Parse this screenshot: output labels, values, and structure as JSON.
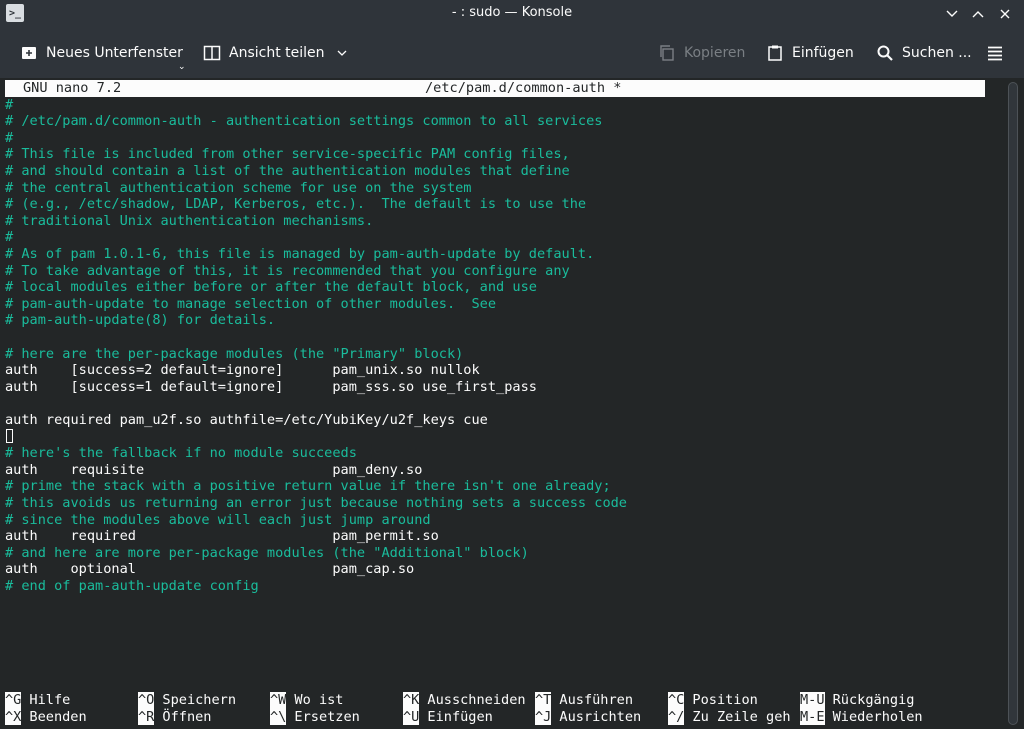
{
  "window": {
    "title": "- : sudo — Konsole",
    "app_icon_glyph": ">_"
  },
  "toolbar": {
    "new_tab": "Neues Unterfenster",
    "split_view": "Ansicht teilen",
    "copy": "Kopieren",
    "paste": "Einfügen",
    "search": "Suchen ..."
  },
  "nano": {
    "version": "GNU nano 7.2",
    "filename": "/etc/pam.d/common-auth *",
    "lines": [
      {
        "text": "#",
        "comment": true
      },
      {
        "text": "# /etc/pam.d/common-auth - authentication settings common to all services",
        "comment": true
      },
      {
        "text": "#",
        "comment": true
      },
      {
        "text": "# This file is included from other service-specific PAM config files,",
        "comment": true
      },
      {
        "text": "# and should contain a list of the authentication modules that define",
        "comment": true
      },
      {
        "text": "# the central authentication scheme for use on the system",
        "comment": true
      },
      {
        "text": "# (e.g., /etc/shadow, LDAP, Kerberos, etc.).  The default is to use the",
        "comment": true
      },
      {
        "text": "# traditional Unix authentication mechanisms.",
        "comment": true
      },
      {
        "text": "#",
        "comment": true
      },
      {
        "text": "# As of pam 1.0.1-6, this file is managed by pam-auth-update by default.",
        "comment": true
      },
      {
        "text": "# To take advantage of this, it is recommended that you configure any",
        "comment": true
      },
      {
        "text": "# local modules either before or after the default block, and use",
        "comment": true
      },
      {
        "text": "# pam-auth-update to manage selection of other modules.  See",
        "comment": true
      },
      {
        "text": "# pam-auth-update(8) for details.",
        "comment": true
      },
      {
        "text": "",
        "comment": false
      },
      {
        "text": "# here are the per-package modules (the \"Primary\" block)",
        "comment": true
      },
      {
        "text": "auth    [success=2 default=ignore]      pam_unix.so nullok",
        "comment": false
      },
      {
        "text": "auth    [success=1 default=ignore]      pam_sss.so use_first_pass",
        "comment": false
      },
      {
        "text": "",
        "comment": false
      },
      {
        "text": "auth required pam_u2f.so authfile=/etc/YubiKey/u2f_keys cue",
        "comment": false
      },
      {
        "text": "",
        "comment": false
      },
      {
        "text": "# here's the fallback if no module succeeds",
        "comment": true
      },
      {
        "text": "auth    requisite                       pam_deny.so",
        "comment": false
      },
      {
        "text": "# prime the stack with a positive return value if there isn't one already;",
        "comment": true
      },
      {
        "text": "# this avoids us returning an error just because nothing sets a success code",
        "comment": true
      },
      {
        "text": "# since the modules above will each just jump around",
        "comment": true
      },
      {
        "text": "auth    required                        pam_permit.so",
        "comment": false
      },
      {
        "text": "# and here are more per-package modules (the \"Additional\" block)",
        "comment": true
      },
      {
        "text": "auth    optional                        pam_cap.so",
        "comment": false
      },
      {
        "text": "# end of pam-auth-update config",
        "comment": true
      }
    ],
    "shortcuts": [
      [
        {
          "key": "^G",
          "label": "Hilfe"
        },
        {
          "key": "^O",
          "label": "Speichern"
        },
        {
          "key": "^W",
          "label": "Wo ist"
        },
        {
          "key": "^K",
          "label": "Ausschneiden"
        },
        {
          "key": "^T",
          "label": "Ausführen"
        },
        {
          "key": "^C",
          "label": "Position"
        },
        {
          "key": "M-U",
          "label": "Rückgängig"
        }
      ],
      [
        {
          "key": "^X",
          "label": "Beenden"
        },
        {
          "key": "^R",
          "label": "Öffnen"
        },
        {
          "key": "^\\",
          "label": "Ersetzen"
        },
        {
          "key": "^U",
          "label": "Einfügen"
        },
        {
          "key": "^J",
          "label": "Ausrichten"
        },
        {
          "key": "^/",
          "label": "Zu Zeile geh"
        },
        {
          "key": "M-E",
          "label": "Wiederholen"
        }
      ]
    ]
  },
  "colors": {
    "comment": "#1abc9c",
    "terminal_bg": "#232627",
    "chrome_bg": "#2f343a"
  }
}
